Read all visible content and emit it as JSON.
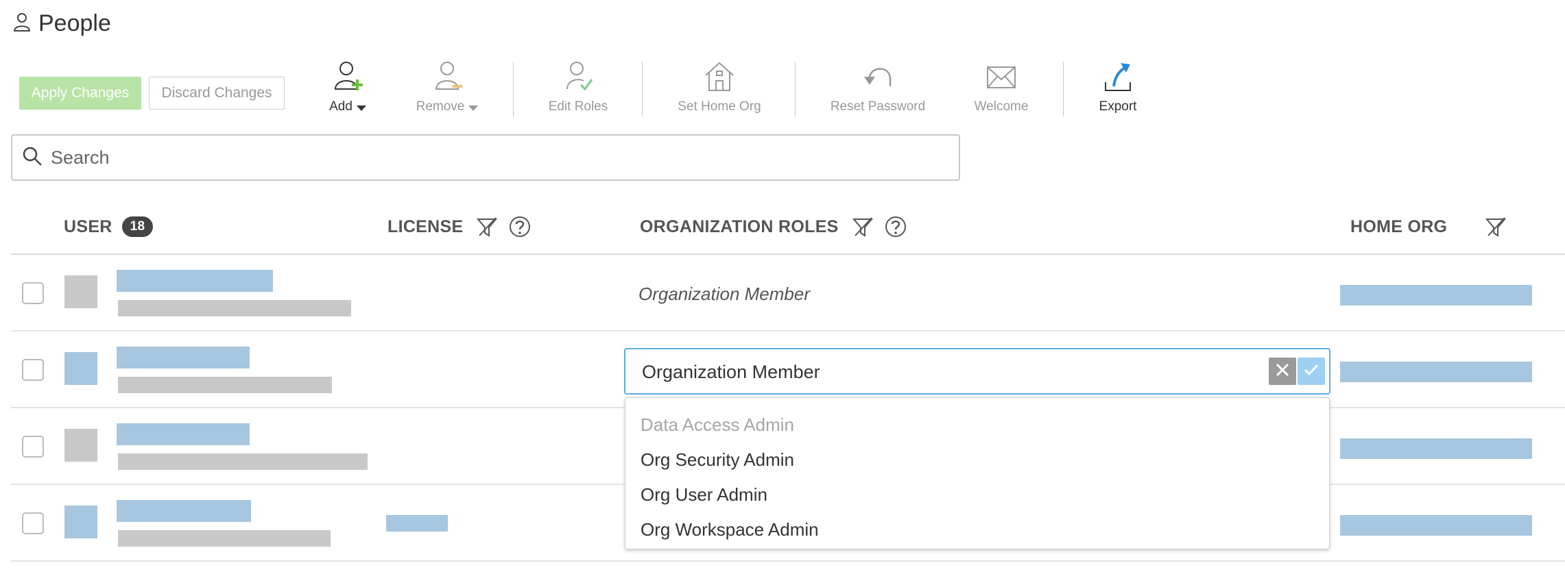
{
  "page": {
    "title": "People",
    "icon": "person-outline-icon"
  },
  "toolbar": {
    "apply_label": "Apply Changes",
    "discard_label": "Discard Changes",
    "tools": {
      "add": {
        "label": "Add",
        "icon": "add-user-icon"
      },
      "remove": {
        "label": "Remove",
        "icon": "remove-user-icon"
      },
      "edit_roles": {
        "label": "Edit Roles",
        "icon": "edit-roles-icon"
      },
      "set_home_org": {
        "label": "Set Home Org",
        "icon": "home-icon"
      },
      "reset_password": {
        "label": "Reset Password",
        "icon": "undo-arrow-icon"
      },
      "welcome": {
        "label": "Welcome",
        "icon": "envelope-icon"
      },
      "export": {
        "label": "Export",
        "icon": "export-icon"
      }
    }
  },
  "search": {
    "placeholder": "Search",
    "value": ""
  },
  "table": {
    "headers": {
      "user": "USER",
      "user_count": "18",
      "license": "LICENSE",
      "org_roles": "ORGANIZATION ROLES",
      "home_org": "HOME ORG"
    },
    "rows": [
      {
        "avatar": "gray",
        "role": "Organization Member",
        "has_license": false
      },
      {
        "avatar": "blue",
        "role": "Organization Member",
        "editing": true,
        "has_license": false
      },
      {
        "avatar": "gray",
        "role": "",
        "has_license": false
      },
      {
        "avatar": "blue",
        "role": "",
        "has_license": true
      }
    ]
  },
  "role_editor": {
    "value": "Organization Member",
    "options": [
      {
        "label": "Data Access Admin",
        "disabled": true
      },
      {
        "label": "Org Security Admin",
        "disabled": false
      },
      {
        "label": "Org User Admin",
        "disabled": false
      },
      {
        "label": "Org Workspace Admin",
        "disabled": false
      }
    ]
  },
  "colors": {
    "apply_bg": "#b8e3a6",
    "placeholder_blue": "#a7c6df",
    "placeholder_gray": "#c8c8c8",
    "focus_border": "#5aaee0",
    "add_plus": "#6cbf3a",
    "export_arrow": "#2a8bd6"
  }
}
